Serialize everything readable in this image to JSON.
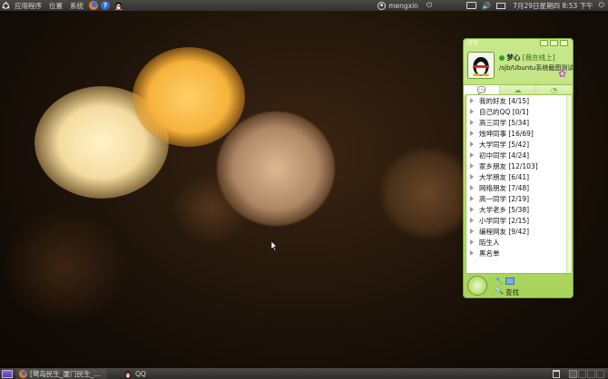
{
  "top_panel": {
    "menus": [
      "应用程序",
      "位置",
      "系统"
    ],
    "user": "mengxin",
    "datetime": "7月29日星期四  8:53 下午"
  },
  "taskbar": {
    "tasks": [
      {
        "label": "[鹭岛民生_厦门民生_..."
      },
      {
        "label": "QQ"
      }
    ]
  },
  "qq": {
    "nickname": "梦心",
    "status": "[我在线上]",
    "signature": "/sjb/Ubuntu系统截图测试",
    "groups": [
      "我的好友 [4/15]",
      "自己的QQ [0/1]",
      "高三同学 [5/34]",
      "烛坤同事 [16/69]",
      "大学同学 [5/42]",
      "初中同学 [4/24]",
      "家乡朋友 [12/103]",
      "大学朋友 [6/41]",
      "网络朋友 [7/48]",
      "高一同学 [2/19]",
      "大学老乡 [5/38]",
      "小学同学 [2/15]",
      "编程网友 [9/42]",
      "陌生人",
      "黑名单"
    ],
    "find_label": "查找"
  },
  "colors": {
    "qq_green": "#a8d45a",
    "panel": "#3c3b37"
  },
  "icons": [
    "ubuntu-logo-icon",
    "firefox-icon",
    "help-icon",
    "qq-penguin-icon",
    "user-icon",
    "power-icon",
    "keyboard-icon",
    "volume-icon",
    "mail-icon",
    "trash-icon",
    "mouse-pointer-icon"
  ]
}
